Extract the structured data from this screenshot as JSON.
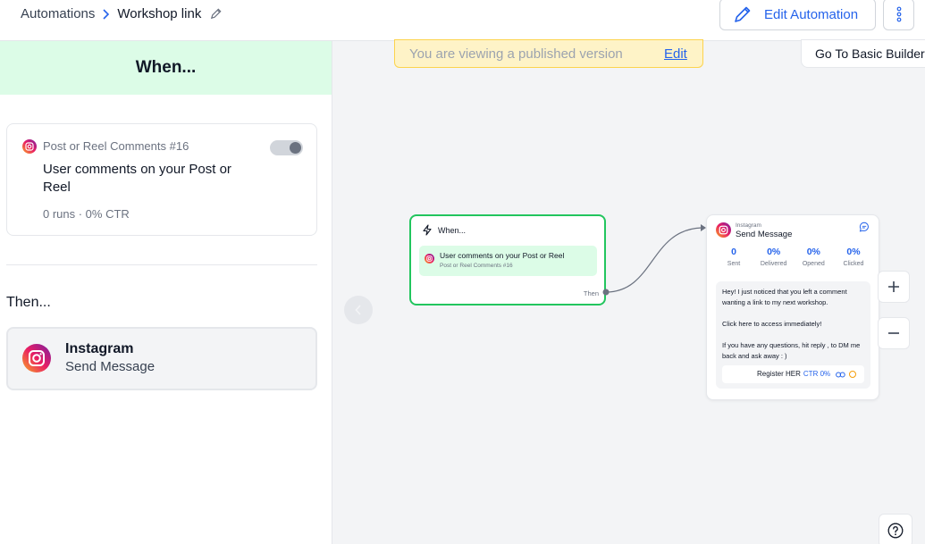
{
  "header": {
    "breadcrumb_root": "Automations",
    "breadcrumb_current": "Workshop link",
    "edit_automation_label": "Edit Automation"
  },
  "left_panel": {
    "when_title": "When...",
    "trigger": {
      "title": "Post or Reel Comments #16",
      "description": "User comments on your Post or Reel",
      "stats": "0 runs · 0% CTR"
    },
    "then_title": "Then...",
    "action": {
      "title": "Instagram",
      "subtitle": "Send Message"
    }
  },
  "canvas": {
    "published_notice": "You are viewing a published version",
    "published_edit": "Edit",
    "basic_builder_label": "Go To Basic Builder",
    "when_node": {
      "title": "When...",
      "trigger_title": "User comments on your Post or Reel",
      "trigger_subtitle": "Post or Reel Comments #16",
      "then_label": "Then"
    },
    "send_node": {
      "platform": "Instagram",
      "title": "Send Message",
      "stats": [
        {
          "value": "0",
          "label": "Sent"
        },
        {
          "value": "0%",
          "label": "Delivered"
        },
        {
          "value": "0%",
          "label": "Opened"
        },
        {
          "value": "0%",
          "label": "Clicked"
        }
      ],
      "message_p1": "Hey! I just noticed that you left a comment wanting a link to my next workshop.",
      "message_p2": "Click here to access immediately!",
      "message_p3": "If you have any questions, hit reply , to DM me back and ask away : )",
      "button_label": "Register HER",
      "button_ctr": "CTR 0%"
    }
  },
  "colors": {
    "accent_blue": "#2563eb",
    "when_green": "#22c55e",
    "when_bg": "#dcfce7",
    "notice_bg": "#fef3c7"
  }
}
